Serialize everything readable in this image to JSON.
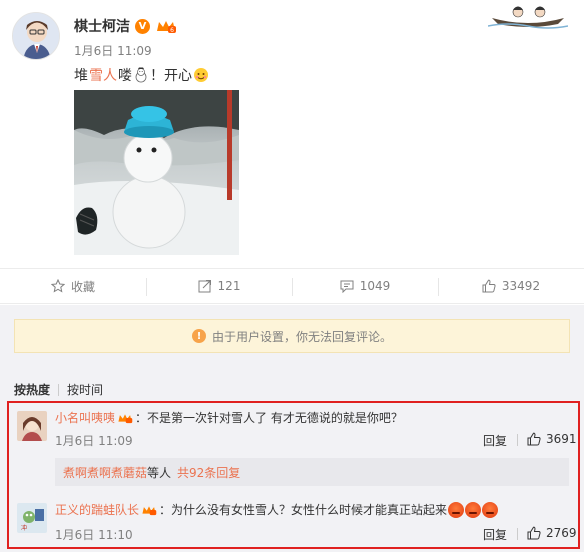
{
  "post": {
    "author": "棋士柯洁",
    "time": "1月6日 11:09",
    "text_before": "堆",
    "text_highlight": "雪人",
    "text_after": "喽",
    "text_tail": "！开心",
    "image_alt": "snowman with blue bucket hat"
  },
  "actions": {
    "favorite": "收藏",
    "repost_count": "121",
    "comment_count": "1049",
    "like_count": "33492"
  },
  "notice": {
    "text": "由于用户设置，你无法回复评论。"
  },
  "sort": {
    "hot": "按热度",
    "time": "按时间"
  },
  "comments": [
    {
      "user": "小名叫咦咦",
      "text": "：不是第一次针对雪人了 有才无德说的就是你吧？",
      "time": "1月6日 11:09",
      "reply_label": "回复",
      "likes": "3691",
      "subreply": {
        "user": "煮啊煮啊煮蘑菇",
        "mid": " 等人 ",
        "more": "共92条回复"
      }
    },
    {
      "user": "正义的踹蛙队长",
      "text": "：为什么没有女性雪人？女性什么时候才能真正站起来",
      "time": "1月6日 11:10",
      "reply_label": "回复",
      "likes": "2769"
    }
  ],
  "colors": {
    "accent": "#eb7350",
    "highlight_border": "#e02020",
    "vip_orange": "#ff8200",
    "notice_bg": "#fdf4d9"
  }
}
